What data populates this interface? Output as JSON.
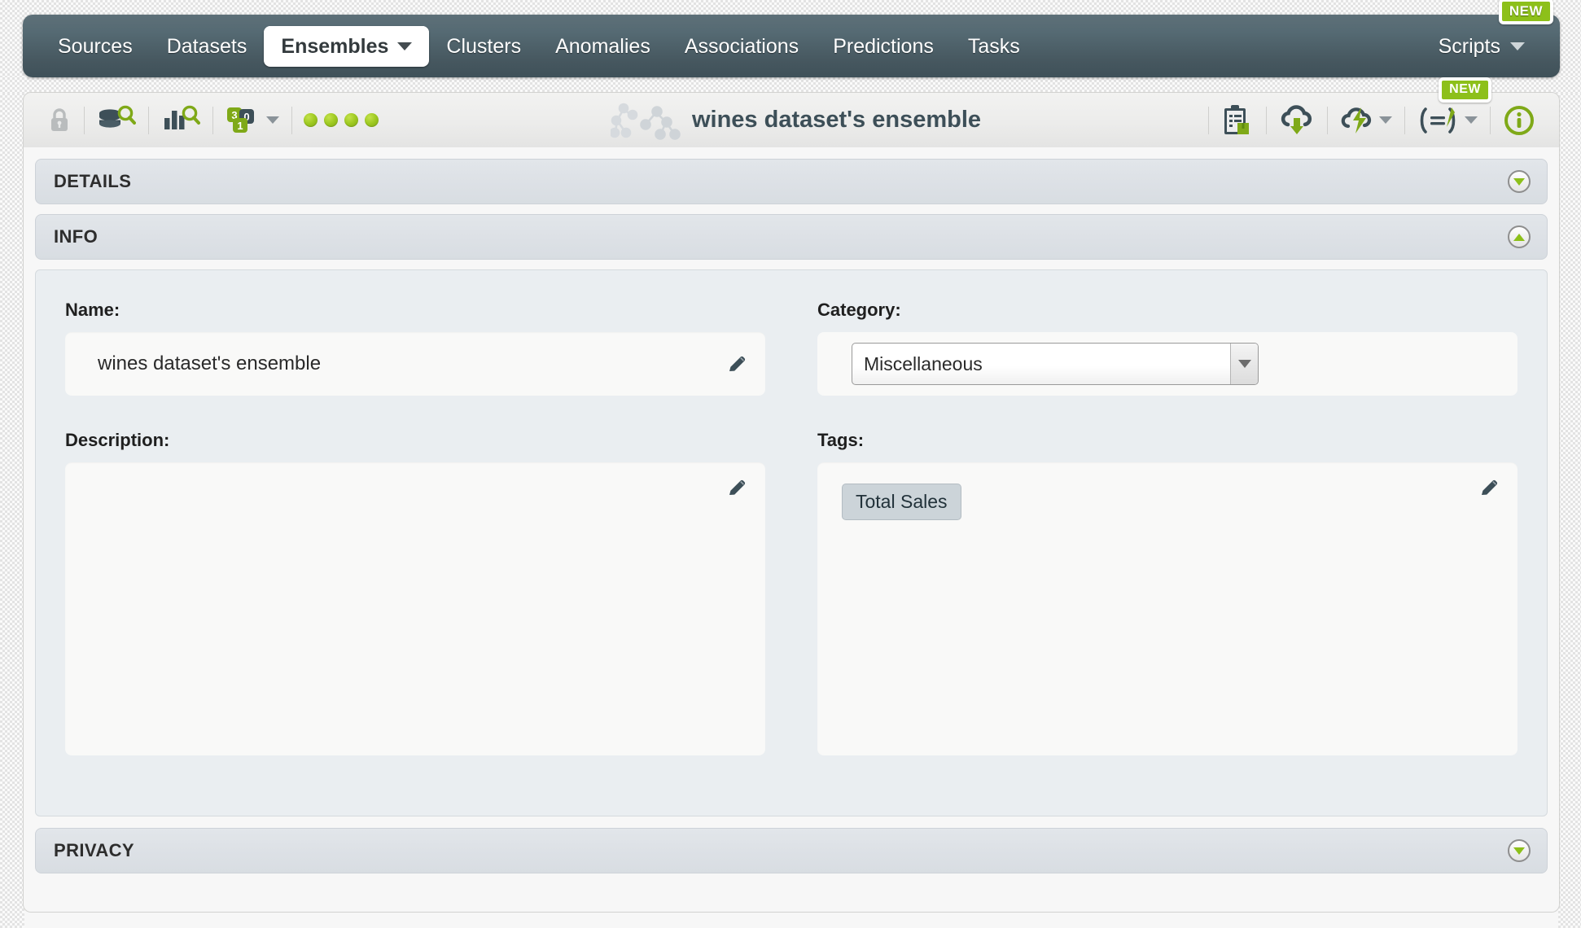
{
  "nav": {
    "items": [
      {
        "label": "Sources",
        "name": "nav-sources",
        "active": false
      },
      {
        "label": "Datasets",
        "name": "nav-datasets",
        "active": false
      },
      {
        "label": "Ensembles",
        "name": "nav-ensembles",
        "active": true
      },
      {
        "label": "Clusters",
        "name": "nav-clusters",
        "active": false
      },
      {
        "label": "Anomalies",
        "name": "nav-anomalies",
        "active": false
      },
      {
        "label": "Associations",
        "name": "nav-associations",
        "active": false
      },
      {
        "label": "Predictions",
        "name": "nav-predictions",
        "active": false
      },
      {
        "label": "Tasks",
        "name": "nav-tasks",
        "active": false
      }
    ],
    "scripts_label": "Scripts",
    "new_badge": "NEW",
    "bg_color": "#4b5e66"
  },
  "toolbar": {
    "title": "wines dataset's ensemble",
    "left_icons": [
      {
        "name": "lock-icon",
        "title": "Privacy"
      },
      {
        "name": "source-search-icon",
        "title": "Source"
      },
      {
        "name": "dataset-search-icon",
        "title": "Dataset"
      },
      {
        "name": "models-icon",
        "title": "Models"
      }
    ],
    "status_dots": 4,
    "status_dot_color": "#9dc820",
    "right_icons": [
      {
        "name": "clipboard-download-icon",
        "title": "Download"
      },
      {
        "name": "cloud-download-icon",
        "title": "Export"
      },
      {
        "name": "batch-prediction-icon",
        "title": "Batch prediction"
      },
      {
        "name": "evaluate-icon",
        "title": "Evaluate"
      },
      {
        "name": "info-icon",
        "title": "Info"
      }
    ],
    "new_badge": "NEW"
  },
  "sections": {
    "details": {
      "label": "DETAILS",
      "expanded": false
    },
    "info": {
      "label": "INFO",
      "expanded": true
    },
    "privacy": {
      "label": "PRIVACY",
      "expanded": false
    }
  },
  "info": {
    "name_label": "Name:",
    "name_value": "wines dataset's ensemble",
    "description_label": "Description:",
    "description_value": "",
    "description_placeholder": "",
    "category_label": "Category:",
    "category_value": "Miscellaneous",
    "category_options": [
      "Miscellaneous"
    ],
    "tags_label": "Tags:",
    "tags": [
      "Total Sales"
    ]
  },
  "colors": {
    "accent_green": "#8dc01a",
    "dark_slate": "#3d4f58",
    "panel_bg": "#eaeef1"
  }
}
